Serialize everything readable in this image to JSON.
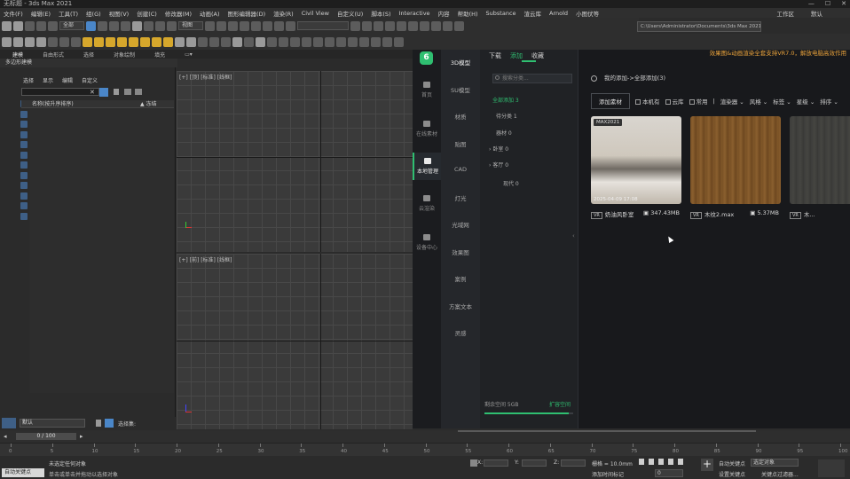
{
  "window": {
    "title": "无标题 - 3ds Max 2021"
  },
  "menu": [
    "文件(F)",
    "编辑(E)",
    "工具(T)",
    "组(G)",
    "视图(V)",
    "创建(C)",
    "修改器(M)",
    "动画(A)",
    "图形编辑器(D)",
    "渲染(R)",
    "Civil View",
    "自定义(U)",
    "脚本(S)",
    "Interactive",
    "内容",
    "帮助(H)",
    "Substance",
    "渲云库",
    "Arnold",
    "小图伏等"
  ],
  "menu_right": {
    "workspace": "工作区",
    "default": "默认"
  },
  "toolbar": {
    "selection_filter": "全部",
    "view_combo": "视图",
    "path": "C:\\Users\\Administrator\\Documents\\3ds Max 2021"
  },
  "ribbon": {
    "tabs": [
      "建模",
      "自由形式",
      "选择",
      "对象绘制",
      "填充"
    ],
    "sub": "多边形建模"
  },
  "explorer": {
    "menu": [
      "选择",
      "显示",
      "编辑",
      "自定义"
    ],
    "col_name": "名称(按升序排序)",
    "col_frozen": "▲ 冻结",
    "layer_default": "默认",
    "selection_set": "选择集:"
  },
  "viewports": {
    "top_label": "[+] [顶] [标准] [线框]",
    "front_label": "[+] [前] [标准] [线框]"
  },
  "promo": "效果图&动画渲染全套支持VR7.0，解放电脑高效作用",
  "plugin": {
    "logo": "6",
    "nav": [
      {
        "label": "首页"
      },
      {
        "label": "在线素材"
      },
      {
        "label": "本地管理"
      },
      {
        "label": "云渲染"
      },
      {
        "label": "设备中心"
      }
    ],
    "categories": [
      "3D模型",
      "SU模型",
      "材质",
      "贴图",
      "CAD",
      "灯光",
      "光域网",
      "效果图",
      "案例",
      "方案文本",
      "灵感"
    ],
    "tabs": [
      "下载",
      "添加",
      "收藏"
    ],
    "search_placeholder": "搜索分类...",
    "tree": [
      {
        "label": "全部添加 3"
      },
      {
        "label": "待分类 1"
      },
      {
        "label": "器材 0"
      },
      {
        "label": "卧室 0"
      },
      {
        "label": "客厅 0"
      },
      {
        "label": "现代 0"
      }
    ],
    "space_text": "剩余空间 5GB",
    "space_link": "扩容空间",
    "space_used": 0.95,
    "breadcrumb": "我的添加->全部添加(3)",
    "add_button": "添加素材",
    "filters": [
      "本机有",
      "云库",
      "常用"
    ],
    "dropdowns": [
      "渲染器",
      "风格",
      "标签",
      "星级",
      "排序"
    ],
    "cards": [
      {
        "badge": "MAX2021",
        "date": "2025-04-09 17:08",
        "vr": "VR",
        "name": "奶油风卧室",
        "size": "347.43MB"
      },
      {
        "badge": "",
        "date": "",
        "vr": "VR",
        "name": "木纹2.max",
        "size": "5.37MB"
      },
      {
        "badge": "",
        "date": "",
        "vr": "VR",
        "name": "木...",
        "size": ""
      }
    ]
  },
  "timeline": {
    "frame": "0 / 100",
    "ticks": [
      "0",
      "5",
      "10",
      "15",
      "20",
      "25",
      "30",
      "35",
      "40",
      "45",
      "50",
      "55",
      "60",
      "65",
      "70",
      "75",
      "80",
      "85",
      "90",
      "95",
      "100"
    ]
  },
  "status": {
    "line1": "未选定任何对象",
    "line2": "单击或单击并拖动以选择对象",
    "autokey": "自动关键点",
    "grid": "栅格 = 10.0mm",
    "add_time_tag": "添加时间标记",
    "selected": "选定对象",
    "set_key": "设置关键点",
    "key_filter": "关键点过滤器...",
    "frame_value": "0",
    "x_label": "X:",
    "y_label": "Y:",
    "z_label": "Z:"
  }
}
